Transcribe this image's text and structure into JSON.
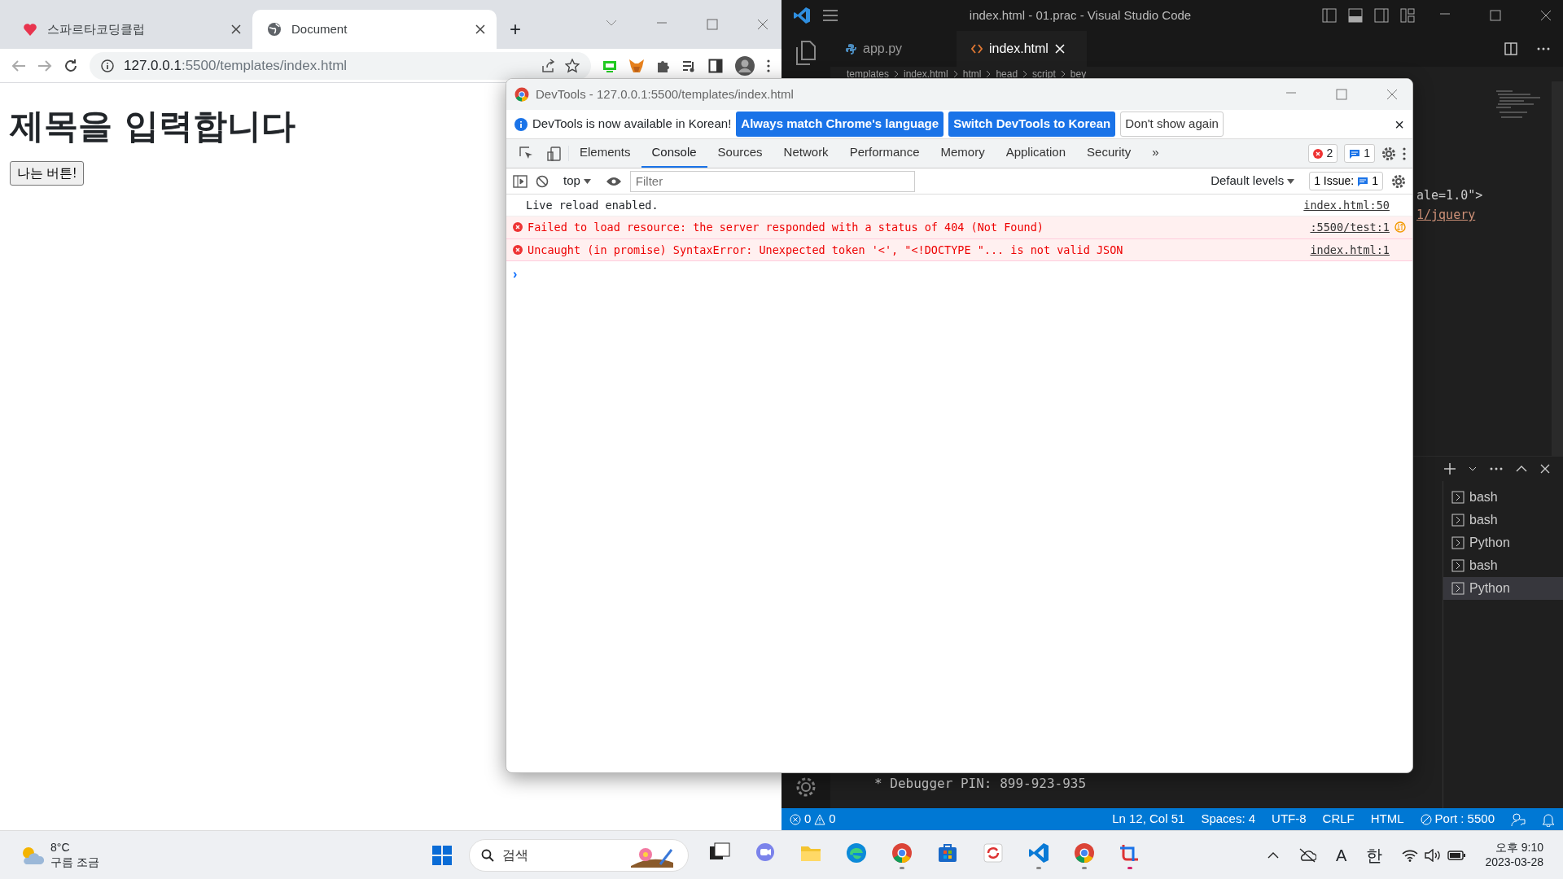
{
  "browser": {
    "tabs": [
      {
        "title": "스파르타코딩클럽",
        "kind": "sparta",
        "selected": false
      },
      {
        "title": "Document",
        "kind": "globe",
        "selected": true
      }
    ],
    "new_tab": "+",
    "url_host": "127.0.0.1",
    "url_rest": ":5500/templates/index.html",
    "page": {
      "heading": "제목을 입력합니다",
      "button": "나는 버튼!"
    }
  },
  "devtools": {
    "title": "DevTools - 127.0.0.1:5500/templates/index.html",
    "infobar": {
      "message": "DevTools is now available in Korean!",
      "close": "×",
      "buttons": [
        {
          "label": "Always match Chrome's language",
          "kind": "primary"
        },
        {
          "label": "Switch DevTools to Korean",
          "kind": "primary"
        },
        {
          "label": "Don't show again",
          "kind": "secondary"
        }
      ]
    },
    "tabs": [
      {
        "label": "Elements",
        "selected": false
      },
      {
        "label": "Console",
        "selected": true
      },
      {
        "label": "Sources",
        "selected": false
      },
      {
        "label": "Network",
        "selected": false
      },
      {
        "label": "Performance",
        "selected": false
      },
      {
        "label": "Memory",
        "selected": false
      },
      {
        "label": "Application",
        "selected": false
      },
      {
        "label": "Security",
        "selected": false
      }
    ],
    "more_tabs": "»",
    "error_count": "2",
    "message_count": "1",
    "toolbar": {
      "context": "top",
      "filter_placeholder": "Filter",
      "levels": "Default levels",
      "issues_label": "1 Issue:",
      "issues_count": "1"
    },
    "console": [
      {
        "kind": "log",
        "text": "Live reload enabled.",
        "source": "index.html:50"
      },
      {
        "kind": "error",
        "text": "Failed to load resource: the server responded with a status of 404 (Not Found)",
        "source": ":5500/test:1"
      },
      {
        "kind": "error",
        "text": "Uncaught (in promise) SyntaxError: Unexpected token '<', \"<!DOCTYPE \"... is not valid JSON",
        "source": "index.html:1"
      }
    ],
    "prompt": "›"
  },
  "vscode": {
    "title": "index.html - 01.prac - Visual Studio Code",
    "tabs": [
      {
        "label": "app.py",
        "kind": "python",
        "selected": false
      },
      {
        "label": "index.html",
        "kind": "html",
        "selected": true
      }
    ],
    "breadcrumb": [
      "templates",
      "index.html",
      "html",
      "head",
      "script",
      "bey"
    ],
    "code_fragments": [
      {
        "text": "ale=1.0\">",
        "kind": "plain"
      },
      {
        "text": "1/jquery",
        "kind": "link"
      }
    ],
    "terminal_output": "* Debugger PIN: 899-923-935",
    "terminals": [
      {
        "label": "bash",
        "selected": false
      },
      {
        "label": "bash",
        "selected": false
      },
      {
        "label": "Python",
        "selected": false
      },
      {
        "label": "bash",
        "selected": false
      },
      {
        "label": "Python",
        "selected": true
      }
    ],
    "status_bar": {
      "errors": "0",
      "warnings": "0",
      "items": [
        "Ln 12, Col 51",
        "Spaces: 4",
        "UTF-8",
        "CRLF",
        "HTML"
      ],
      "port": "Port : 5500"
    }
  },
  "taskbar": {
    "temperature": "8°C",
    "weather": "구름 조금",
    "search_placeholder": "검색",
    "apps": [
      {
        "kind": "task-view",
        "running": false
      },
      {
        "kind": "chat",
        "running": false
      },
      {
        "kind": "folder",
        "running": false
      },
      {
        "kind": "edge",
        "running": false
      },
      {
        "kind": "chrome",
        "running": true
      },
      {
        "kind": "store",
        "running": false
      },
      {
        "kind": "sync",
        "running": false
      },
      {
        "kind": "vscode",
        "running": true
      },
      {
        "kind": "chrome",
        "running": true
      },
      {
        "kind": "snip",
        "running": true
      }
    ],
    "ime_mode": "A",
    "ime_lang": "한",
    "time": "오후 9:10",
    "date": "2023-03-28"
  }
}
